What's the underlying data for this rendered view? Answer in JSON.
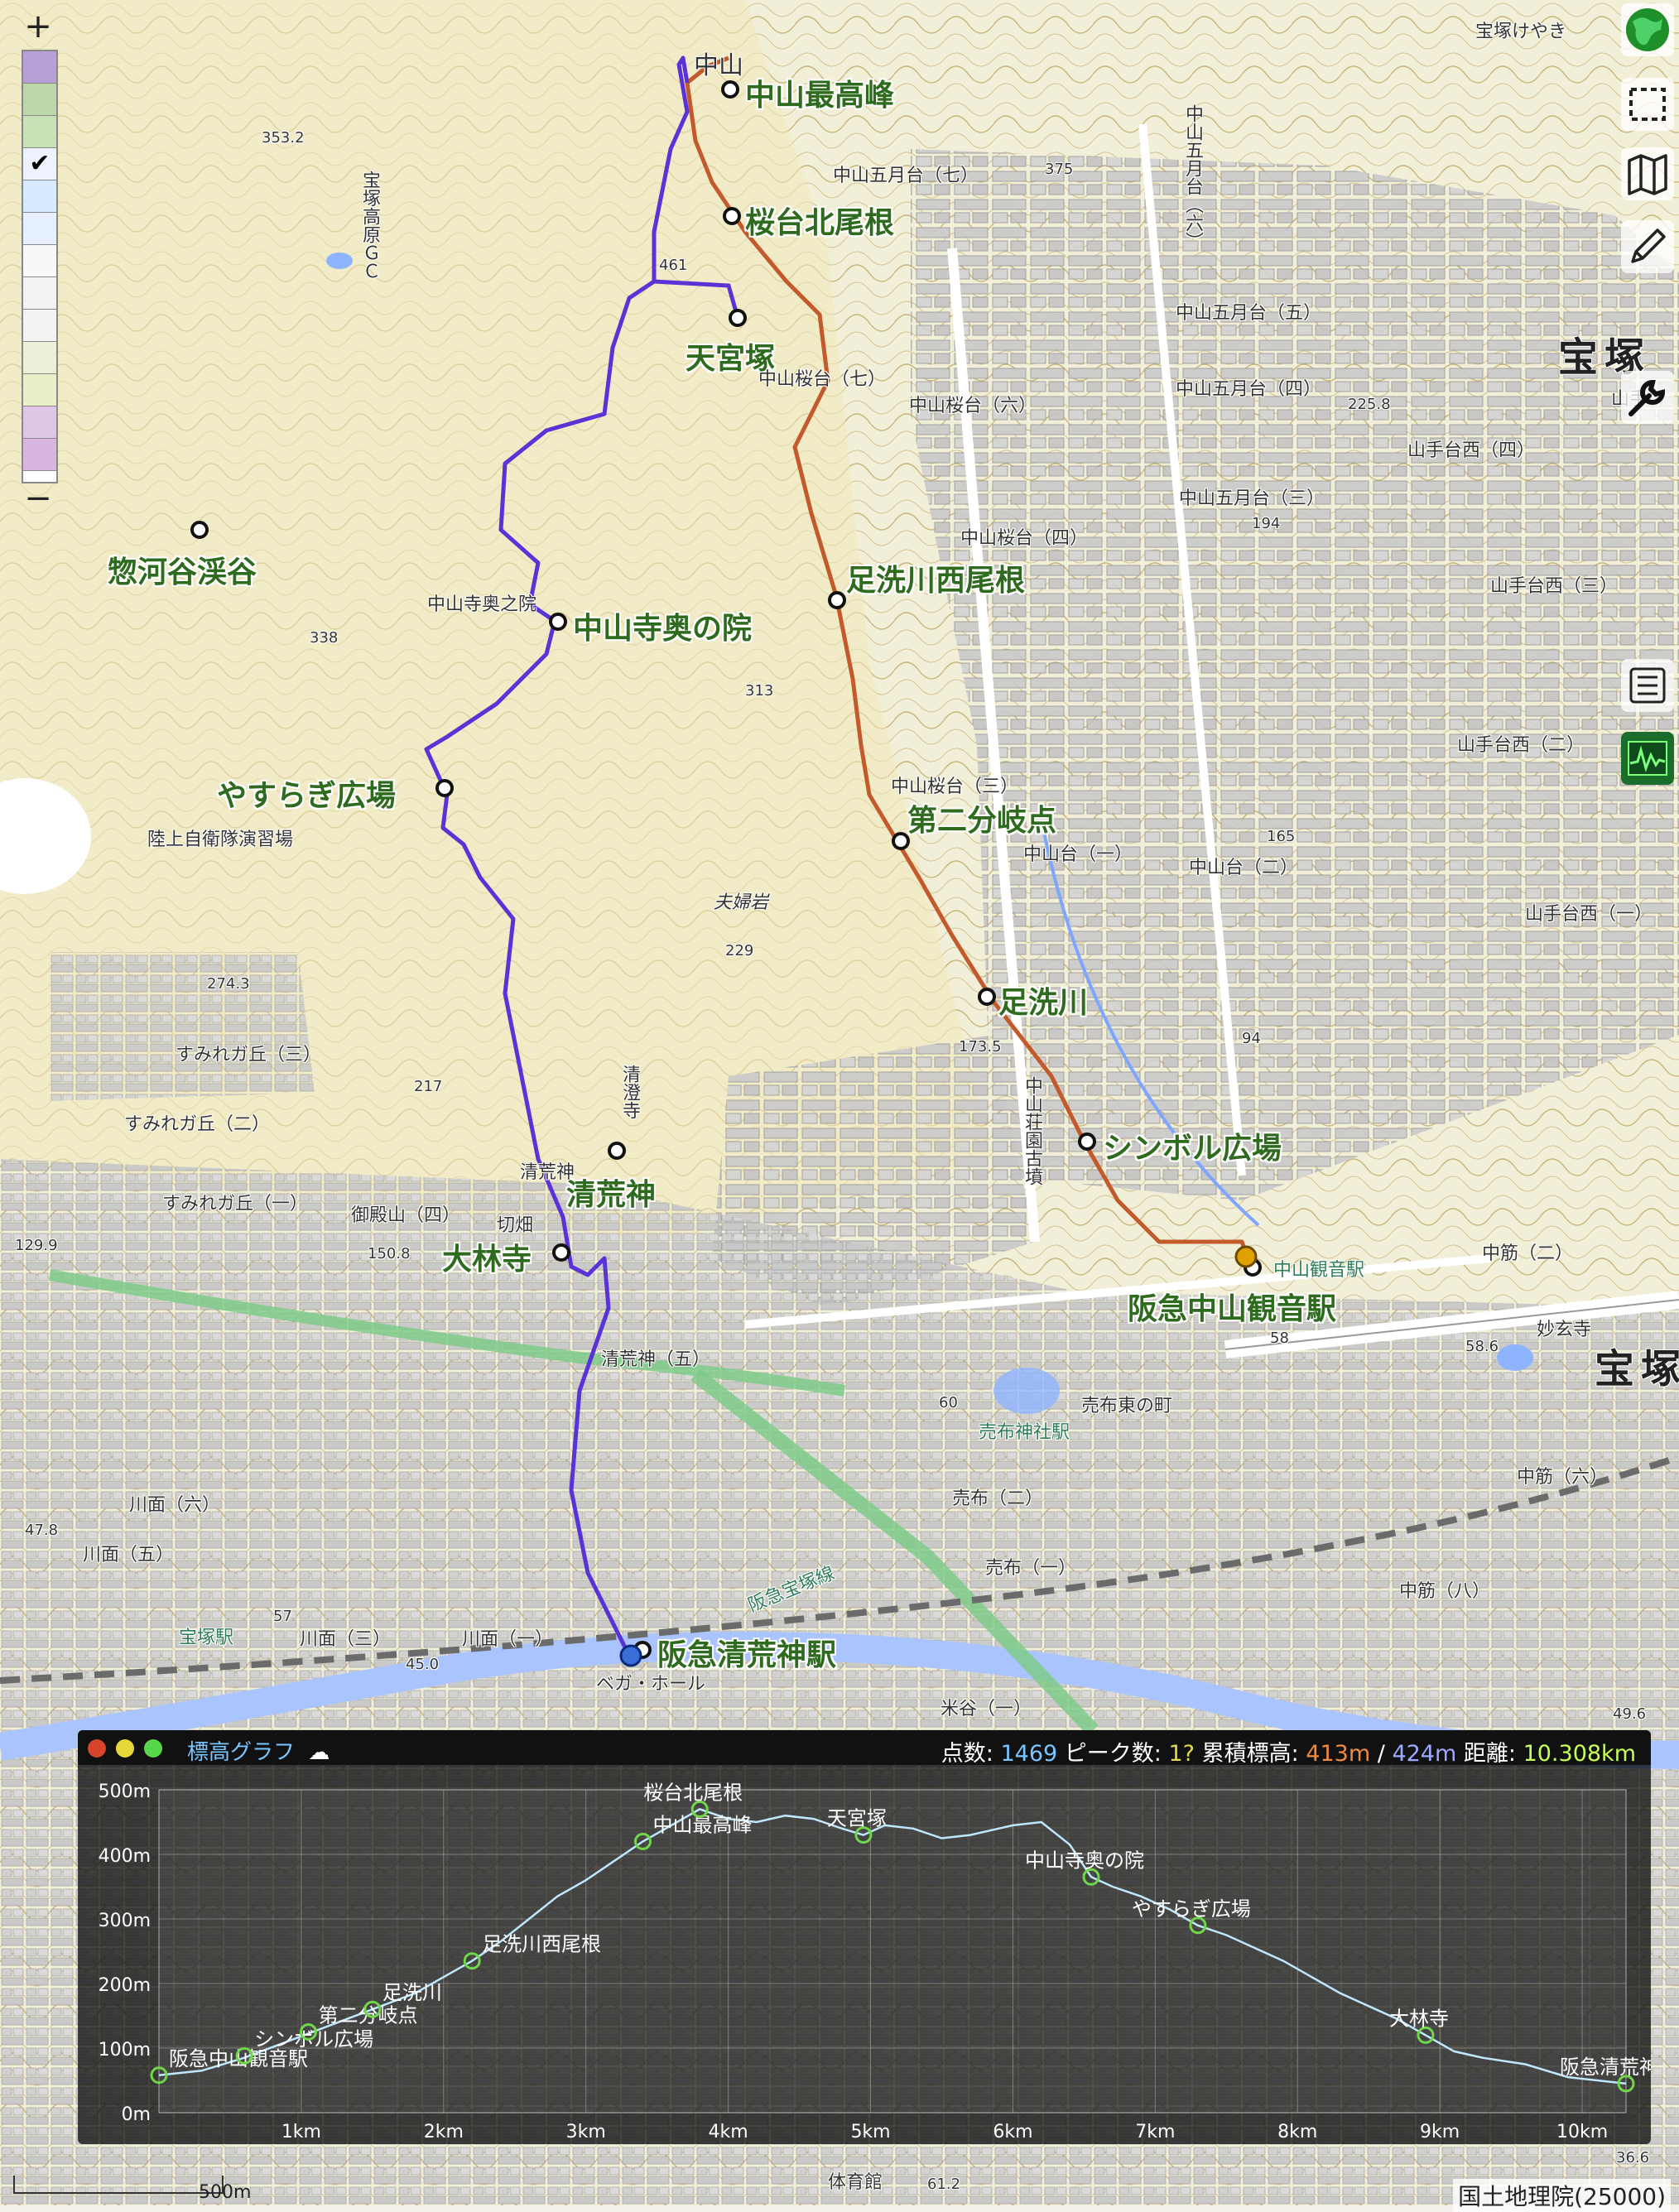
{
  "map": {
    "attribution": "国土地理院(25000)",
    "scale_label": "500m",
    "route_colors": {
      "ascent": "#c25a2c",
      "descent": "#5a33d6"
    },
    "waypoints": [
      {
        "name": "中山最高峰"
      },
      {
        "name": "桜台北尾根"
      },
      {
        "name": "天宮塚"
      },
      {
        "name": "惣河谷渓谷"
      },
      {
        "name": "中山寺奥の院"
      },
      {
        "name": "足洗川西尾根"
      },
      {
        "name": "やすらぎ広場"
      },
      {
        "name": "第二分岐点"
      },
      {
        "name": "足洗川"
      },
      {
        "name": "シンボル広場"
      },
      {
        "name": "清荒神"
      },
      {
        "name": "大林寺"
      },
      {
        "name": "阪急中山観音駅"
      },
      {
        "name": "阪急清荒神駅"
      }
    ],
    "place_labels": [
      "中山",
      "宝塚けやき",
      "中山五月台（七）",
      "中山五月台（六）",
      "中山五月台（五）",
      "中山五月台（四）",
      "中山五月台（三）",
      "中山桜台（七）",
      "中山桜台（六）",
      "中山桜台（四）",
      "中山桜台（三）",
      "中山台（一）",
      "中山台（二）",
      "中山寺奥之院",
      "陸上自衛隊演習場",
      "夫婦岩",
      "すみれガ丘（三）",
      "すみれガ丘（二）",
      "すみれガ丘（一）",
      "御殿山（四）",
      "清澄寺",
      "切畑",
      "清荒神（五）",
      "売布東の町",
      "売布神社駅",
      "中山観音駅",
      "売布（二）",
      "売布（一）",
      "山手台西（四）",
      "山手台西（三）",
      "山手台西（二）",
      "山手台西（一）",
      "中筋（二）",
      "中筋（六）",
      "中筋（八）",
      "川面（六）",
      "川面（五）",
      "川面（三）",
      "川面（一）",
      "宝塚駅",
      "宝塚高原ＧＣ",
      "中山荘園古墳",
      "宝塚",
      "清荒神",
      "米谷（一）",
      "ベガ・ホール",
      "阪急宝塚線",
      "山手",
      "妙玄寺",
      "体育館"
    ],
    "spot_heights": [
      "353.2",
      "375",
      "461",
      "338",
      "313",
      "229",
      "274.3",
      "173.5",
      "217",
      "150.8",
      "129.9",
      "225.8",
      "194",
      "165",
      "94",
      "60",
      "58",
      "47.8",
      "57",
      "45.0",
      "49.6",
      "58.6",
      "36.6",
      "61.2"
    ]
  },
  "elevation_graph": {
    "title": "標高グラフ",
    "stats_text": {
      "points_label": "点数:",
      "points": "1469",
      "peaks_label": "ピーク数:",
      "peaks": "1?",
      "gain_label": "累積標高:",
      "gain": "413m",
      "sep": "/",
      "loss": "424m",
      "dist_label": "距離:",
      "dist": "10.308km"
    },
    "colors": {
      "points": "#79c6ff",
      "peaks": "#e6d84a",
      "gain": "#f08a3c",
      "loss": "#9fa8ff",
      "dist": "#c6ff5a"
    },
    "y_ticks": [
      "500m",
      "400m",
      "300m",
      "200m",
      "100m",
      "0m"
    ],
    "x_ticks": [
      "1km",
      "2km",
      "3km",
      "4km",
      "5km",
      "6km",
      "7km",
      "8km",
      "9km",
      "10km"
    ]
  },
  "chart_data": {
    "type": "line",
    "title": "標高グラフ",
    "xlabel": "",
    "ylabel": "",
    "xlim": [
      0,
      10.308
    ],
    "ylim": [
      0,
      500
    ],
    "x_unit": "km",
    "y_unit": "m",
    "series": [
      {
        "x": [
          0.0,
          0.3,
          0.6,
          0.9,
          1.2,
          1.5,
          1.8,
          2.0,
          2.2,
          2.4,
          2.6,
          2.8,
          3.0,
          3.2,
          3.4,
          3.6,
          3.8,
          4.0,
          4.2,
          4.4,
          4.6,
          4.8,
          4.95,
          5.1,
          5.3,
          5.5,
          5.7,
          5.9,
          6.0,
          6.2,
          6.4,
          6.55,
          6.7,
          6.9,
          7.1,
          7.3,
          7.5,
          7.7,
          7.9,
          8.1,
          8.3,
          8.5,
          8.7,
          8.9,
          9.1,
          9.3,
          9.6,
          9.9,
          10.308
        ],
        "y": [
          58,
          65,
          85,
          110,
          135,
          160,
          185,
          210,
          235,
          265,
          300,
          335,
          360,
          390,
          420,
          445,
          470,
          455,
          450,
          460,
          455,
          440,
          430,
          445,
          440,
          425,
          430,
          440,
          445,
          450,
          415,
          365,
          350,
          335,
          315,
          290,
          275,
          255,
          235,
          210,
          185,
          165,
          145,
          120,
          95,
          85,
          75,
          55,
          45
        ]
      }
    ],
    "annotations": [
      {
        "label": "阪急中山観音駅",
        "x": 0.0,
        "y": 58
      },
      {
        "label": "シンボル広場",
        "x": 0.6,
        "y": 88
      },
      {
        "label": "第二分岐点",
        "x": 1.05,
        "y": 125
      },
      {
        "label": "足洗川",
        "x": 1.5,
        "y": 160
      },
      {
        "label": "足洗川西尾根",
        "x": 2.2,
        "y": 235
      },
      {
        "label": "中山最高峰",
        "x": 3.4,
        "y": 420
      },
      {
        "label": "桜台北尾根",
        "x": 3.8,
        "y": 470
      },
      {
        "label": "天宮塚",
        "x": 4.95,
        "y": 430
      },
      {
        "label": "中山寺奥の院",
        "x": 6.55,
        "y": 365
      },
      {
        "label": "やすらぎ広場",
        "x": 7.3,
        "y": 290
      },
      {
        "label": "大林寺",
        "x": 8.9,
        "y": 120
      },
      {
        "label": "阪急清荒神駅",
        "x": 10.308,
        "y": 45
      }
    ]
  }
}
